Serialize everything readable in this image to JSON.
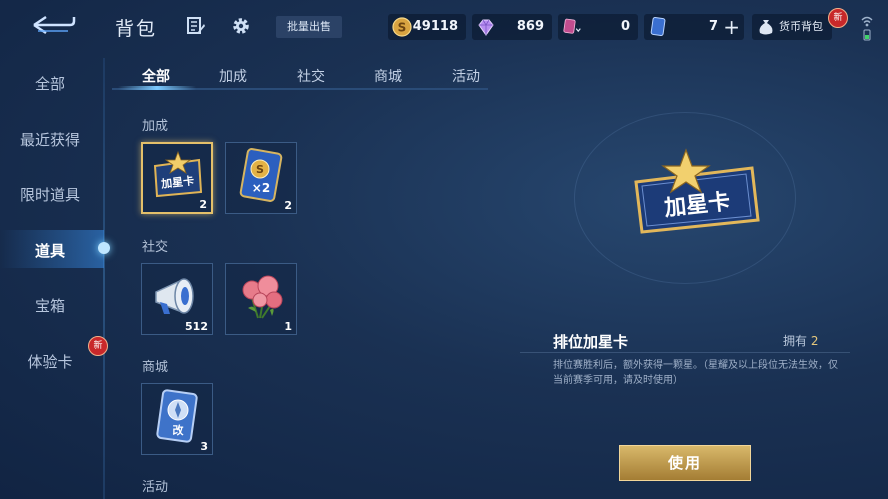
{
  "header": {
    "title": "背包",
    "bulk_sell_label": "批量出售",
    "wallet_label": "货币背包",
    "new_badge": "新",
    "currencies": [
      {
        "name": "gold-coin",
        "value": "49118"
      },
      {
        "name": "gem",
        "value": "869"
      },
      {
        "name": "pink-card",
        "value": "0"
      },
      {
        "name": "blue-card",
        "value": "7"
      }
    ]
  },
  "sidebar": {
    "items": [
      {
        "label": "全部"
      },
      {
        "label": "最近获得"
      },
      {
        "label": "限时道具"
      },
      {
        "label": "道具",
        "active": true
      },
      {
        "label": "宝箱"
      },
      {
        "label": "体验卡",
        "badge": "新"
      }
    ]
  },
  "tabs": [
    {
      "label": "全部",
      "active": true
    },
    {
      "label": "加成"
    },
    {
      "label": "社交"
    },
    {
      "label": "商城"
    },
    {
      "label": "活动"
    }
  ],
  "sections": [
    {
      "title": "加成",
      "items": [
        {
          "name": "rank-star-card",
          "caption": "加星卡",
          "count": "2",
          "selected": true
        },
        {
          "name": "coin-double-card",
          "caption": "×2",
          "count": "2"
        }
      ]
    },
    {
      "title": "社交",
      "items": [
        {
          "name": "megaphone",
          "count": "512"
        },
        {
          "name": "roses",
          "count": "1"
        }
      ]
    },
    {
      "title": "商城",
      "items": [
        {
          "name": "rename-card",
          "caption": "改",
          "count": "3"
        }
      ]
    },
    {
      "title": "活动",
      "items": []
    }
  ],
  "detail": {
    "icon_caption": "加星卡",
    "name": "排位加星卡",
    "owned_label": "拥有",
    "owned_count": "2",
    "description": "排位赛胜利后，额外获得一颗星。（星耀及以上段位无法生效，仅当前赛季可用，请及时使用）",
    "use_label": "使用"
  },
  "colors": {
    "accent_gold": "#e4c06a",
    "badge_red": "#c8282a",
    "active_tab": "#7ccaff"
  }
}
